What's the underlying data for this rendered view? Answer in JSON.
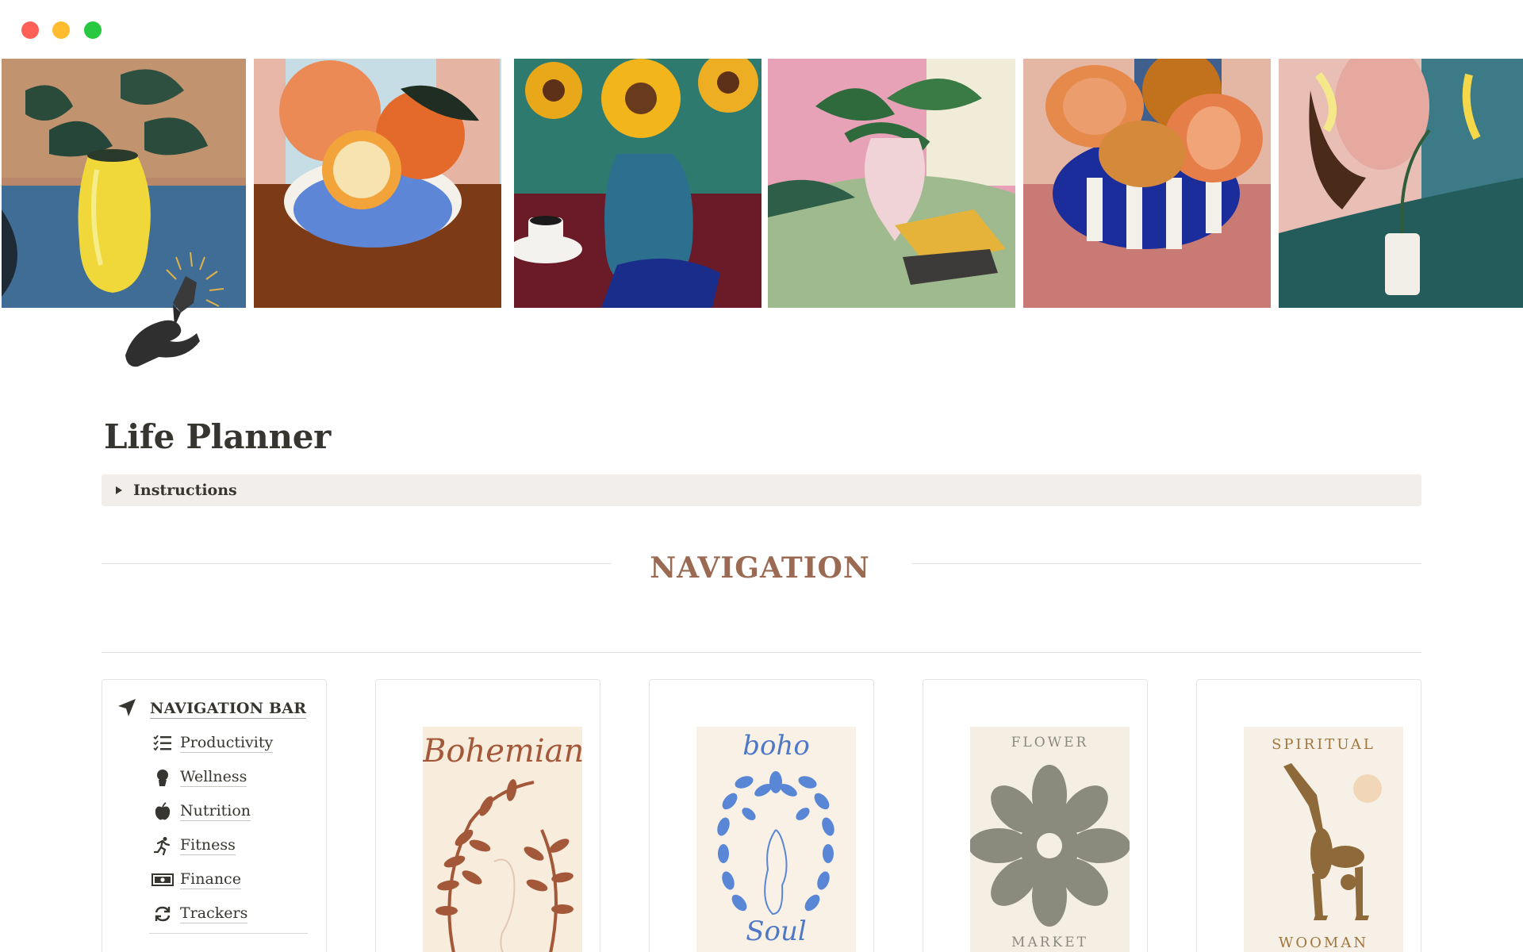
{
  "window": {
    "controls": [
      "close",
      "minimize",
      "maximize"
    ]
  },
  "cover": {
    "panels": [
      "yellow-vase-painting",
      "orange-bowl-painting",
      "sunflower-painting",
      "pink-vase-painting",
      "papaya-bowl-painting",
      "woman-lily-painting"
    ]
  },
  "page": {
    "icon": "hand-crystal-icon",
    "title": "Life Planner"
  },
  "toggle": {
    "label": "Instructions",
    "icon": "triangle-right-icon"
  },
  "section": {
    "heading": "NAVIGATION"
  },
  "nav_card": {
    "title": "NAVIGATION BAR",
    "icon": "navigation-arrow-icon",
    "items": [
      {
        "label": "Productivity",
        "icon": "checklist-icon"
      },
      {
        "label": "Wellness",
        "icon": "person-bust-icon"
      },
      {
        "label": "Nutrition",
        "icon": "apple-icon"
      },
      {
        "label": "Fitness",
        "icon": "running-icon"
      },
      {
        "label": "Finance",
        "icon": "money-icon"
      },
      {
        "label": "Trackers",
        "icon": "refresh-icon"
      }
    ]
  },
  "gallery": [
    {
      "poster": "bohemian-poster",
      "text_top": "Bohemian",
      "text_bottom": ""
    },
    {
      "poster": "boho-soul-poster",
      "text_top": "boho",
      "text_bottom": "Soul"
    },
    {
      "poster": "flower-market-poster",
      "text_top": "FLOWER",
      "text_bottom": "MARKET"
    },
    {
      "poster": "spiritual-wooman-poster",
      "text_top": "SPIRITUAL",
      "text_bottom": "WOOMAN"
    }
  ],
  "colors": {
    "heading_accent": "#9a6b52",
    "toggle_bg": "#f1eeec",
    "text": "#37352f"
  }
}
